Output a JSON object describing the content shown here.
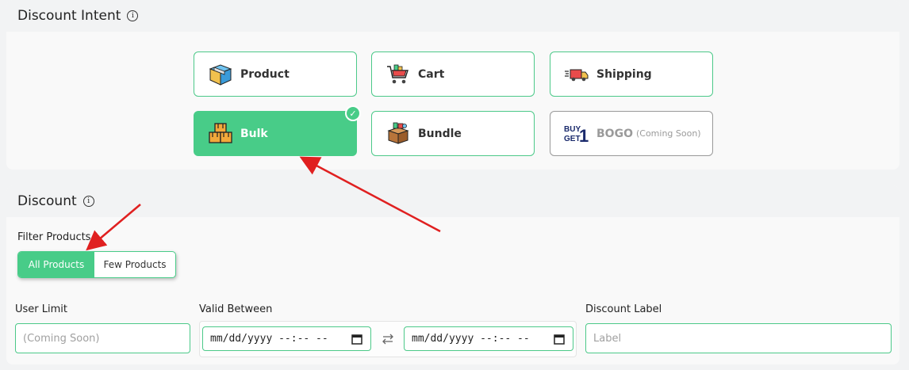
{
  "intent_section": {
    "title": "Discount Intent",
    "info": "i",
    "cards": [
      {
        "label": "Product",
        "icon": "product-box-icon"
      },
      {
        "label": "Cart",
        "icon": "shopping-cart-icon"
      },
      {
        "label": "Shipping",
        "icon": "delivery-truck-icon"
      },
      {
        "label": "Bulk",
        "icon": "stacked-boxes-icon",
        "selected": true
      },
      {
        "label": "Bundle",
        "icon": "bundle-box-icon"
      },
      {
        "label": "BOGO",
        "soon": "(Coming Soon)",
        "icon": "buy-get-1-icon",
        "icon_text_top": "BUY",
        "icon_text_bottom": "GET",
        "icon_text_num": "1"
      }
    ],
    "check_glyph": "✓"
  },
  "discount_section": {
    "title": "Discount",
    "info": "i",
    "filter_label": "Filter Products",
    "filter_options": [
      "All Products",
      "Few Products"
    ],
    "filter_selected": "All Products",
    "user_limit_label": "User Limit",
    "user_limit_placeholder": "(Coming Soon)",
    "valid_between_label": "Valid Between",
    "date_start_placeholder": "mm/dd/yyyy --:-- --",
    "date_end_placeholder": "mm/dd/yyyy --:-- --",
    "discount_label_label": "Discount Label",
    "discount_label_placeholder": "Label"
  },
  "colors": {
    "accent": "#48cc88",
    "arrow": "#e02020",
    "panel_bg": "#f9f9f9",
    "header_bg": "#f2f3f4"
  }
}
